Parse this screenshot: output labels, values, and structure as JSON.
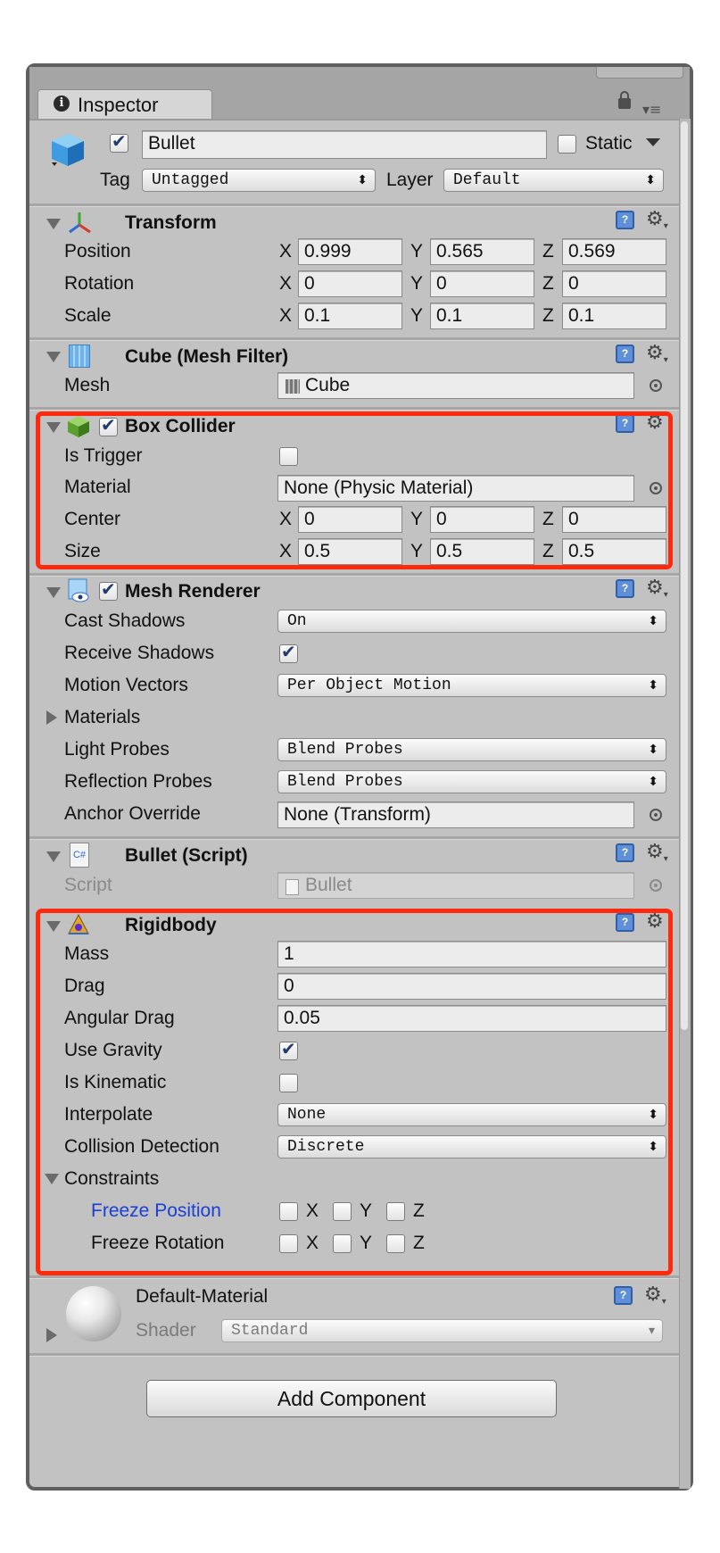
{
  "tab": {
    "title": "Inspector"
  },
  "object": {
    "name": "Bullet",
    "active": true,
    "static_label": "Static",
    "static": false,
    "tag_label": "Tag",
    "tag_value": "Untagged",
    "layer_label": "Layer",
    "layer_value": "Default"
  },
  "transform": {
    "title": "Transform",
    "rows": [
      {
        "label": "Position",
        "x": "0.999",
        "y": "0.565",
        "z": "0.569"
      },
      {
        "label": "Rotation",
        "x": "0",
        "y": "0",
        "z": "0"
      },
      {
        "label": "Scale",
        "x": "0.1",
        "y": "0.1",
        "z": "0.1"
      }
    ]
  },
  "axes": {
    "x": "X",
    "y": "Y",
    "z": "Z"
  },
  "mesh_filter": {
    "title": "Cube (Mesh Filter)",
    "mesh_label": "Mesh",
    "mesh_value": "Cube"
  },
  "box_collider": {
    "title": "Box Collider",
    "enabled": true,
    "is_trigger_label": "Is Trigger",
    "is_trigger": false,
    "material_label": "Material",
    "material_value": "None (Physic Material)",
    "center_label": "Center",
    "center": {
      "x": "0",
      "y": "0",
      "z": "0"
    },
    "size_label": "Size",
    "size": {
      "x": "0.5",
      "y": "0.5",
      "z": "0.5"
    }
  },
  "mesh_renderer": {
    "title": "Mesh Renderer",
    "enabled": true,
    "cast_shadows_label": "Cast Shadows",
    "cast_shadows": "On",
    "receive_shadows_label": "Receive Shadows",
    "receive_shadows": true,
    "motion_vectors_label": "Motion Vectors",
    "motion_vectors": "Per Object Motion",
    "materials_label": "Materials",
    "light_probes_label": "Light Probes",
    "light_probes": "Blend Probes",
    "reflection_probes_label": "Reflection Probes",
    "reflection_probes": "Blend Probes",
    "anchor_override_label": "Anchor Override",
    "anchor_override": "None (Transform)"
  },
  "script": {
    "title": "Bullet (Script)",
    "script_label": "Script",
    "script_value": "Bullet"
  },
  "rigidbody": {
    "title": "Rigidbody",
    "mass_label": "Mass",
    "mass": "1",
    "drag_label": "Drag",
    "drag": "0",
    "angular_drag_label": "Angular Drag",
    "angular_drag": "0.05",
    "use_gravity_label": "Use Gravity",
    "use_gravity": true,
    "is_kinematic_label": "Is Kinematic",
    "is_kinematic": false,
    "interpolate_label": "Interpolate",
    "interpolate": "None",
    "collision_detection_label": "Collision Detection",
    "collision_detection": "Discrete",
    "constraints_label": "Constraints",
    "freeze_position_label": "Freeze Position",
    "freeze_rotation_label": "Freeze Rotation"
  },
  "material": {
    "name": "Default-Material",
    "shader_label": "Shader",
    "shader_value": "Standard"
  },
  "add_component": {
    "label": "Add Component"
  },
  "colors": {
    "highlight": "#ff2a0d",
    "panel": "#c2c2c2",
    "link_blue": "#1a3fd6"
  }
}
